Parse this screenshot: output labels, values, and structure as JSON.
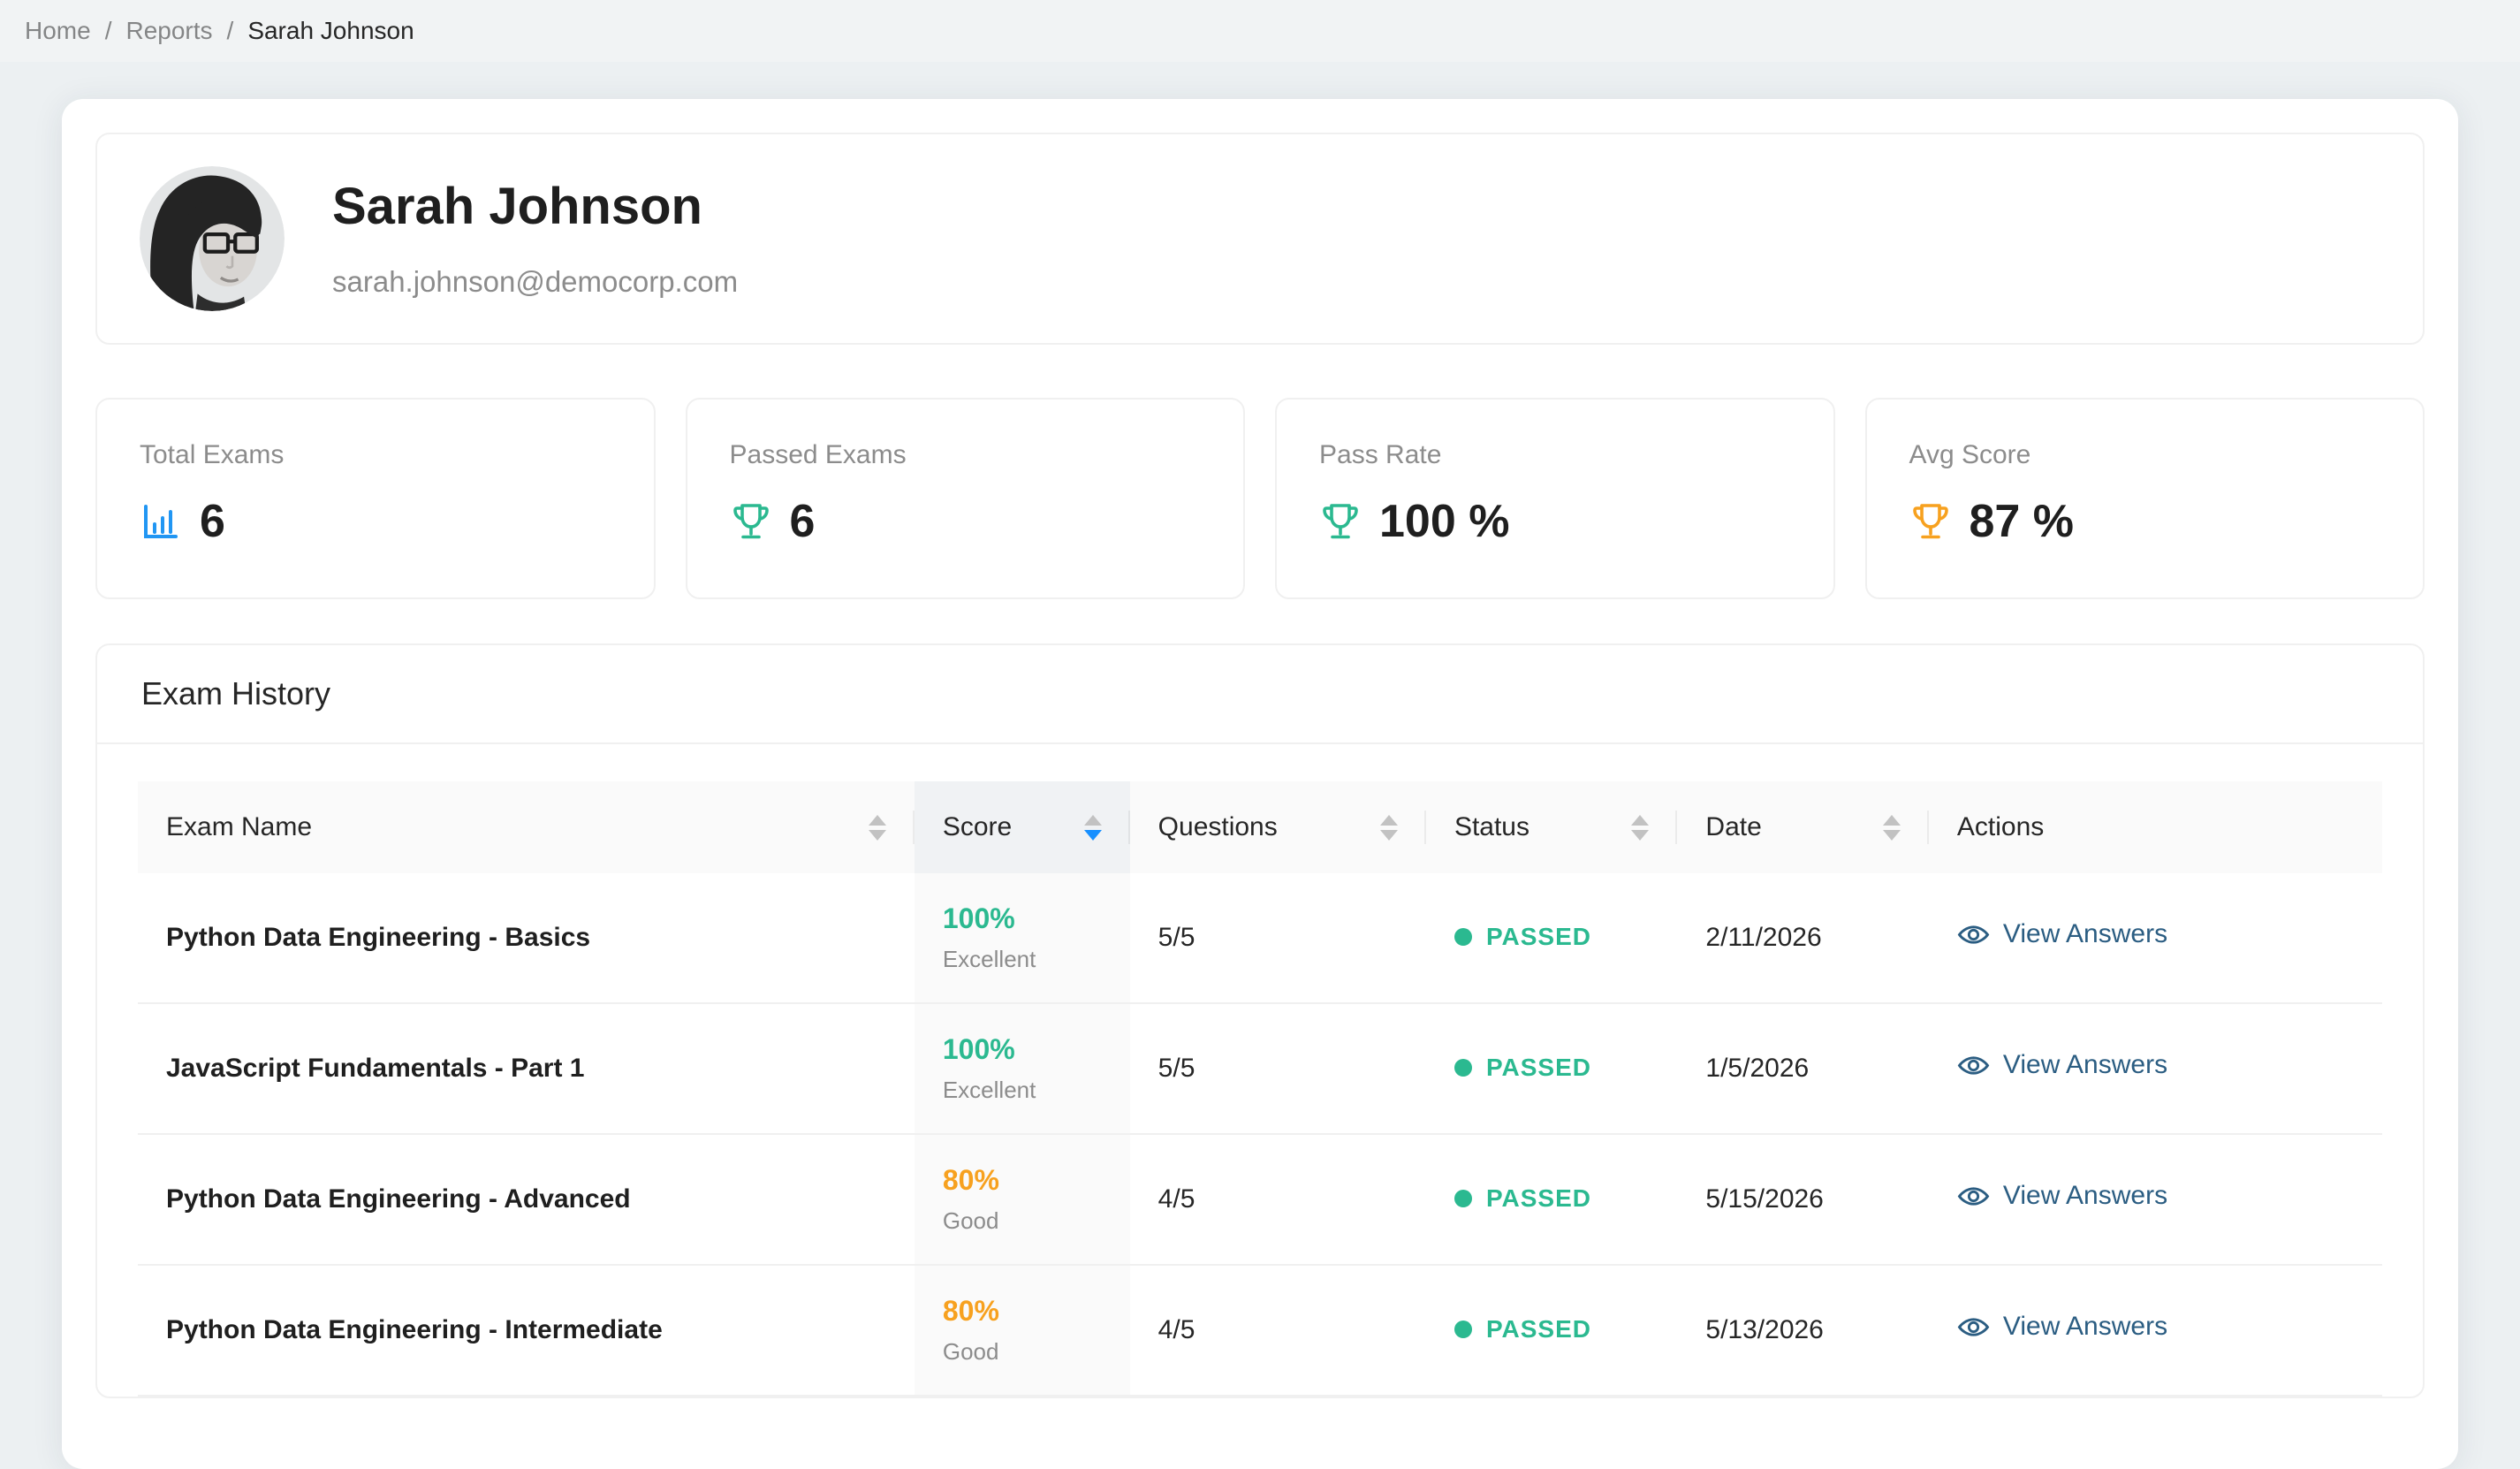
{
  "breadcrumb": {
    "separator": "/",
    "items": [
      {
        "label": "Home"
      },
      {
        "label": "Reports"
      },
      {
        "label": "Sarah Johnson"
      }
    ]
  },
  "profile": {
    "name": "Sarah Johnson",
    "email": "sarah.johnson@democorp.com"
  },
  "stats": [
    {
      "label": "Total Exams",
      "value": "6",
      "icon": "bar-chart-icon",
      "icon_color": "#2196f3"
    },
    {
      "label": "Passed Exams",
      "value": "6",
      "icon": "trophy-icon",
      "icon_color": "#2bb990"
    },
    {
      "label": "Pass Rate",
      "value": "100 %",
      "icon": "trophy-icon",
      "icon_color": "#2bb990"
    },
    {
      "label": "Avg Score",
      "value": "87 %",
      "icon": "trophy-icon",
      "icon_color": "#f7a11f"
    }
  ],
  "exam_history": {
    "title": "Exam History",
    "columns": [
      {
        "label": "Exam Name",
        "sortable": true,
        "sorted": null
      },
      {
        "label": "Score",
        "sortable": true,
        "sorted": "desc"
      },
      {
        "label": "Questions",
        "sortable": true,
        "sorted": null
      },
      {
        "label": "Status",
        "sortable": true,
        "sorted": null
      },
      {
        "label": "Date",
        "sortable": true,
        "sorted": null
      },
      {
        "label": "Actions",
        "sortable": false,
        "sorted": null
      }
    ],
    "rows": [
      {
        "exam_name": "Python Data Engineering - Basics",
        "score": "100%",
        "score_label": "Excellent",
        "score_color": "#2bb990",
        "questions": "5/5",
        "status": "PASSED",
        "date": "2/11/2026",
        "action": "View Answers"
      },
      {
        "exam_name": "JavaScript Fundamentals - Part 1",
        "score": "100%",
        "score_label": "Excellent",
        "score_color": "#2bb990",
        "questions": "5/5",
        "status": "PASSED",
        "date": "1/5/2026",
        "action": "View Answers"
      },
      {
        "exam_name": "Python Data Engineering - Advanced",
        "score": "80%",
        "score_label": "Good",
        "score_color": "#f7a11f",
        "questions": "4/5",
        "status": "PASSED",
        "date": "5/15/2026",
        "action": "View Answers"
      },
      {
        "exam_name": "Python Data Engineering - Intermediate",
        "score": "80%",
        "score_label": "Good",
        "score_color": "#f7a11f",
        "questions": "4/5",
        "status": "PASSED",
        "date": "5/13/2026",
        "action": "View Answers"
      }
    ]
  },
  "colors": {
    "success_teal": "#2bb990",
    "warning_orange": "#f7a11f",
    "info_blue": "#2196f3",
    "link_blue": "#2b5d82",
    "sort_active_blue": "#1890ff"
  }
}
